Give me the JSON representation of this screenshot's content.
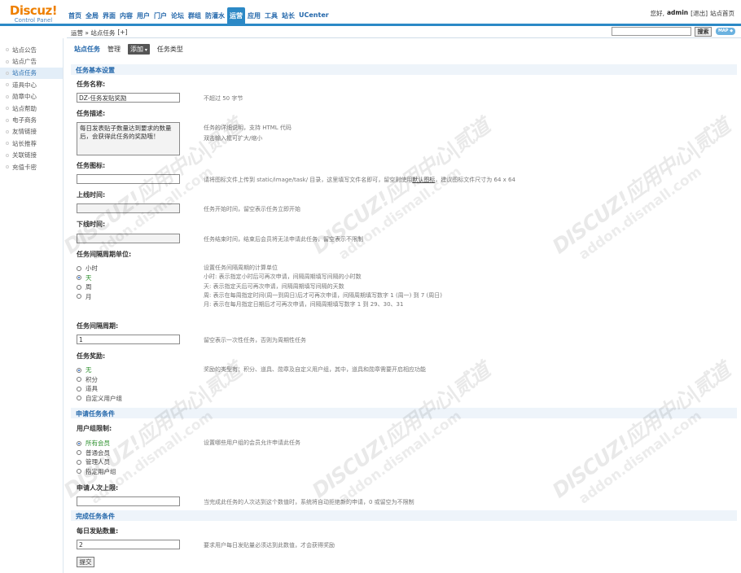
{
  "logo": {
    "brand": "Discuz!",
    "sub": "Control Panel"
  },
  "topnav": [
    {
      "label": "首页",
      "active": false
    },
    {
      "label": "全局",
      "active": false
    },
    {
      "label": "界面",
      "active": false
    },
    {
      "label": "内容",
      "active": false
    },
    {
      "label": "用户",
      "active": false
    },
    {
      "label": "门户",
      "active": false
    },
    {
      "label": "论坛",
      "active": false
    },
    {
      "label": "群组",
      "active": false
    },
    {
      "label": "防灌水",
      "active": false
    },
    {
      "label": "运营",
      "active": true
    },
    {
      "label": "应用",
      "active": false
    },
    {
      "label": "工具",
      "active": false
    },
    {
      "label": "站长",
      "active": false
    },
    {
      "label": "UCenter",
      "active": false
    }
  ],
  "user": {
    "greeting": "您好,",
    "name": "admin",
    "logout": "[退出]",
    "home": "站点首页"
  },
  "breadcrumb": {
    "text": "运营 » 站点任务",
    "add": "[+]"
  },
  "search": {
    "value": "",
    "button": "搜索",
    "map": "MAP ◆"
  },
  "sidebar": {
    "items": [
      {
        "label": "站点公告",
        "active": false
      },
      {
        "label": "站点广告",
        "active": false
      },
      {
        "label": "站点任务",
        "active": true
      },
      {
        "label": "道具中心",
        "active": false
      },
      {
        "label": "勋章中心",
        "active": false
      },
      {
        "label": "站点帮助",
        "active": false
      },
      {
        "label": "电子商务",
        "active": false
      },
      {
        "label": "友情链接",
        "active": false
      },
      {
        "label": "站长推荐",
        "active": false
      },
      {
        "label": "关联链接",
        "active": false
      },
      {
        "label": "充值卡密",
        "active": false
      }
    ]
  },
  "tabs": {
    "title": "站点任务",
    "manage": "管理",
    "add": "添加",
    "types": "任务类型"
  },
  "sections": {
    "basic": "任务基本设置",
    "apply": "申请任务条件",
    "complete": "完成任务条件"
  },
  "form": {
    "name": {
      "label": "任务名称:",
      "value": "DZ-任务发贴奖励",
      "hint": "不超过 50 字节"
    },
    "desc": {
      "label": "任务描述:",
      "value": "每日发表贴子数量达到要求的数量后，会获得此任务的奖励哦！",
      "hint1": "任务的详细说明，支持 HTML 代码",
      "hint2": "双击输入框可扩大/缩小"
    },
    "icon": {
      "label": "任务图标:",
      "value": "",
      "hint_pre": "请将图标文件上传到 static/image/task/ 目录，这里填写文件名即可，留空则使用",
      "hint_link": "默认图标",
      "hint_post": "，建议图标文件尺寸为 64 x 64"
    },
    "start": {
      "label": "上线时间:",
      "value": "",
      "hint": "任务开始时间，留空表示任务立即开始"
    },
    "end": {
      "label": "下线时间:",
      "value": "",
      "hint": "任务结束时间，结束后会员将无法申请此任务，留空表示不限制"
    },
    "period_unit": {
      "label": "任务间隔周期单位:",
      "options": [
        "小时",
        "天",
        "周",
        "月"
      ],
      "selected": "天",
      "hints": [
        "设置任务间隔周期的计算单位",
        "小时: 表示指定小时后可再次申请，间隔周期填写间隔的小时数",
        "天: 表示指定天后可再次申请，间隔周期填写间隔的天数",
        "周: 表示在每周指定时间(周一到周日)后才可再次申请，间隔周期填写数字 1 (周一) 到 7 (周日)",
        "月: 表示在每月指定日期后才可再次申请，间隔周期填写数字 1 到 29、30、31"
      ]
    },
    "period": {
      "label": "任务间隔周期:",
      "value": "1",
      "hint": "留空表示一次性任务，否则为周期性任务"
    },
    "reward": {
      "label": "任务奖励:",
      "options": [
        "无",
        "积分",
        "道具",
        "自定义用户组"
      ],
      "selected": "无",
      "hint": "奖励的类型有：积分、道具、勋章及自定义用户组，其中，道具和勋章需要开启相应功能"
    },
    "usergroup": {
      "label": "用户组限制:",
      "options": [
        "所有会员",
        "普通会员",
        "管理人员",
        "指定用户组"
      ],
      "selected": "所有会员",
      "hint": "设置哪些用户组的会员允许申请此任务"
    },
    "limit": {
      "label": "申请人次上限:",
      "value": "",
      "hint": "当完成此任务的人次达到这个数值时，系统将自动拒绝新的申请，0 或留空为不限制"
    },
    "posts": {
      "label": "每日发贴数量:",
      "value": "2",
      "hint": "要求用户每日发贴量必须达到此数值，才会获得奖励"
    },
    "submit": "提交"
  },
  "watermark": {
    "line1": "DISCUZ!应用中心|贰道",
    "line2": "addon.dismall.com"
  }
}
